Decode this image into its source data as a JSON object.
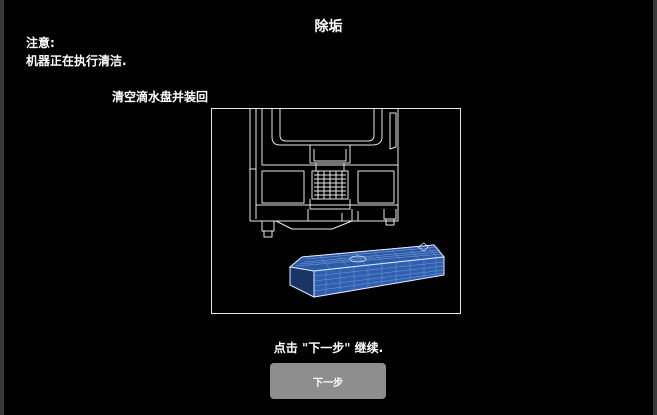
{
  "screen": {
    "title": "除垢",
    "notice_label": "注意:",
    "notice_text": "机器正在执行清洁.",
    "step_instruction": "清空滴水盘并装回",
    "continue_text": "点击 \"下一步\" 继续.",
    "next_button_label": "下一步"
  },
  "illustration": {
    "subject": "coffee-machine-drip-tray",
    "highlight_color": "#2e5fb0"
  },
  "colors": {
    "background": "#000000",
    "text": "#ffffff",
    "button": "#8e8e8e"
  }
}
